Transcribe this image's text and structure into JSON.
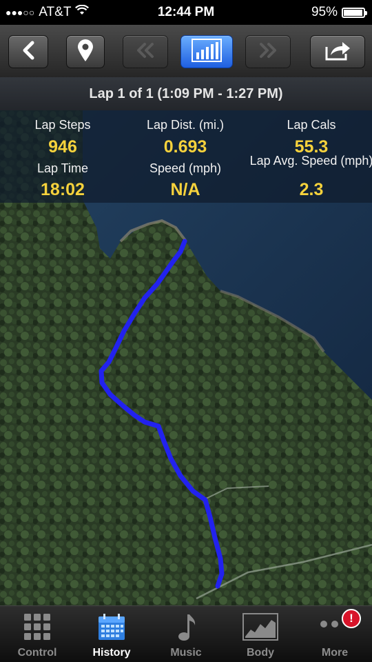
{
  "status_bar": {
    "signal_dots": "●●●○○",
    "carrier": "AT&T",
    "time": "12:44 PM",
    "battery_percent_text": "95%",
    "battery_level": 0.95
  },
  "toolbar": {
    "back_icon": "back-chevron-icon",
    "map_pin_icon": "map-pin-icon",
    "prev_icon": "double-chevron-left-icon",
    "chart_icon": "bar-chart-icon",
    "next_icon": "double-chevron-right-icon",
    "share_icon": "share-icon"
  },
  "lap_title": "Lap 1 of 1 (1:09 PM - 1:27 PM)",
  "stats": {
    "lap_steps_label": "Lap Steps",
    "lap_steps_value": "946",
    "lap_dist_label": "Lap Dist. (mi.)",
    "lap_dist_value": "0.693",
    "lap_cals_label": "Lap Cals",
    "lap_cals_value": "55.3",
    "lap_time_label": "Lap Time",
    "lap_time_value": "18:02",
    "speed_label": "Speed (mph)",
    "speed_value": "N/A",
    "lap_avg_speed_label": "Lap Avg. Speed (mph)",
    "lap_avg_speed_value": "2.3"
  },
  "colors": {
    "route": "#2222ee",
    "stat_value": "#f6d23c",
    "active_tab": "#3b8fe8",
    "badge": "#d8142a"
  },
  "tabs": [
    {
      "label": "Control",
      "icon": "grid-icon",
      "active": false
    },
    {
      "label": "History",
      "icon": "calendar-icon",
      "active": true
    },
    {
      "label": "Music",
      "icon": "music-note-icon",
      "active": false
    },
    {
      "label": "Body",
      "icon": "body-chart-icon",
      "active": false
    },
    {
      "label": "More",
      "icon": "more-dots-icon",
      "active": false,
      "badge": "!"
    }
  ]
}
